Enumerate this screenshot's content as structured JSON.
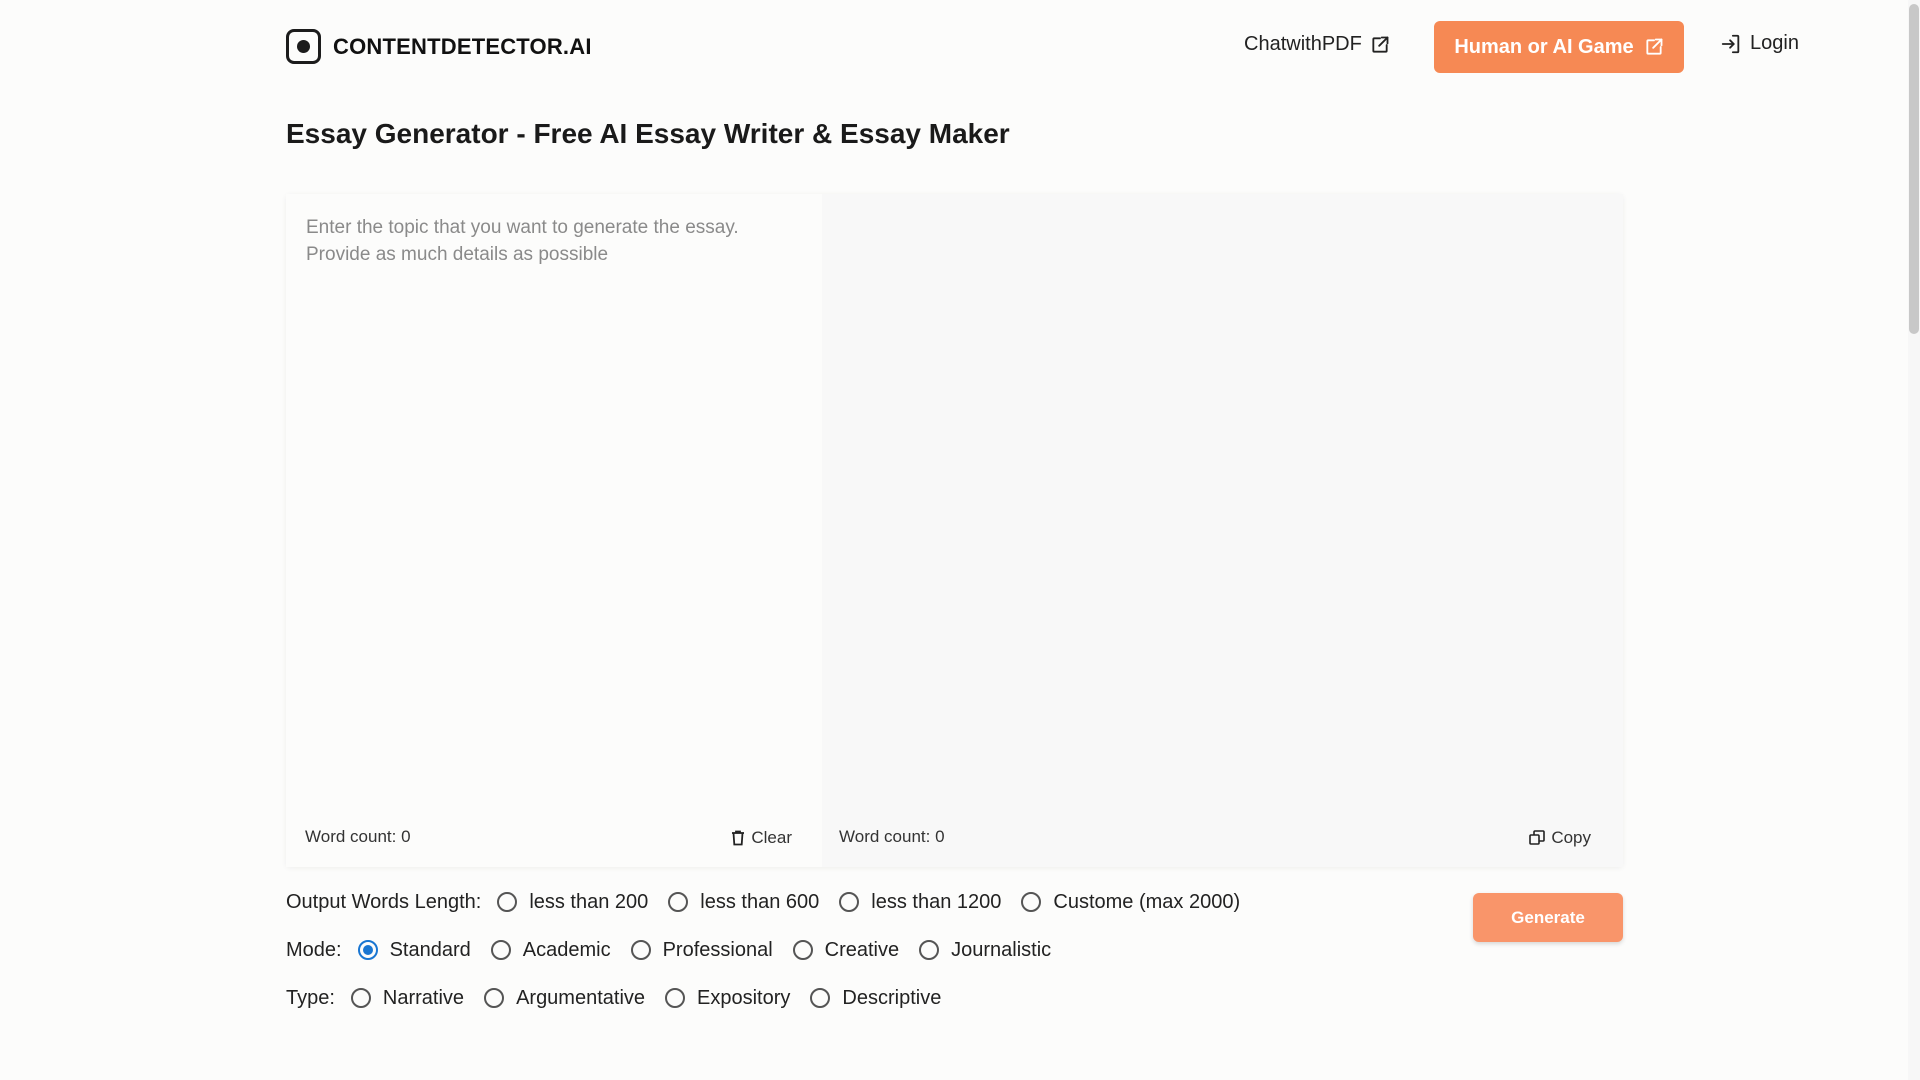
{
  "header": {
    "logo_text": "CONTENTDETECTOR.AI",
    "nav": {
      "chatpdf": "ChatwithPDF",
      "game": "Human or AI Game",
      "login": "Login"
    }
  },
  "page": {
    "title": "Essay Generator - Free AI Essay Writer & Essay Maker"
  },
  "editor": {
    "input_placeholder": "Enter the topic that you want to generate the essay.\nProvide as much details as possible",
    "input_value": "",
    "left_word_count": "Word count: 0",
    "clear_label": "Clear",
    "right_word_count": "Word count: 0",
    "copy_label": "Copy"
  },
  "options": {
    "length": {
      "label": "Output Words Length:",
      "choices": [
        "less than 200",
        "less than 600",
        "less than 1200",
        "Custome (max 2000)"
      ],
      "selected": null
    },
    "mode": {
      "label": "Mode:",
      "choices": [
        "Standard",
        "Academic",
        "Professional",
        "Creative",
        "Journalistic"
      ],
      "selected": "Standard"
    },
    "type": {
      "label": "Type:",
      "choices": [
        "Narrative",
        "Argumentative",
        "Expository",
        "Descriptive"
      ],
      "selected": null
    }
  },
  "generate_label": "Generate",
  "colors": {
    "accent": "#f68954",
    "generate_bg": "#f9956a",
    "radio_checked": "#1976d2",
    "page_bg": "#fcfcfb"
  },
  "icons": {
    "logo": "record-icon",
    "chatpdf": "external-link-icon",
    "game": "external-link-icon",
    "login": "login-icon",
    "clear": "trash-icon",
    "copy": "copy-icon"
  }
}
